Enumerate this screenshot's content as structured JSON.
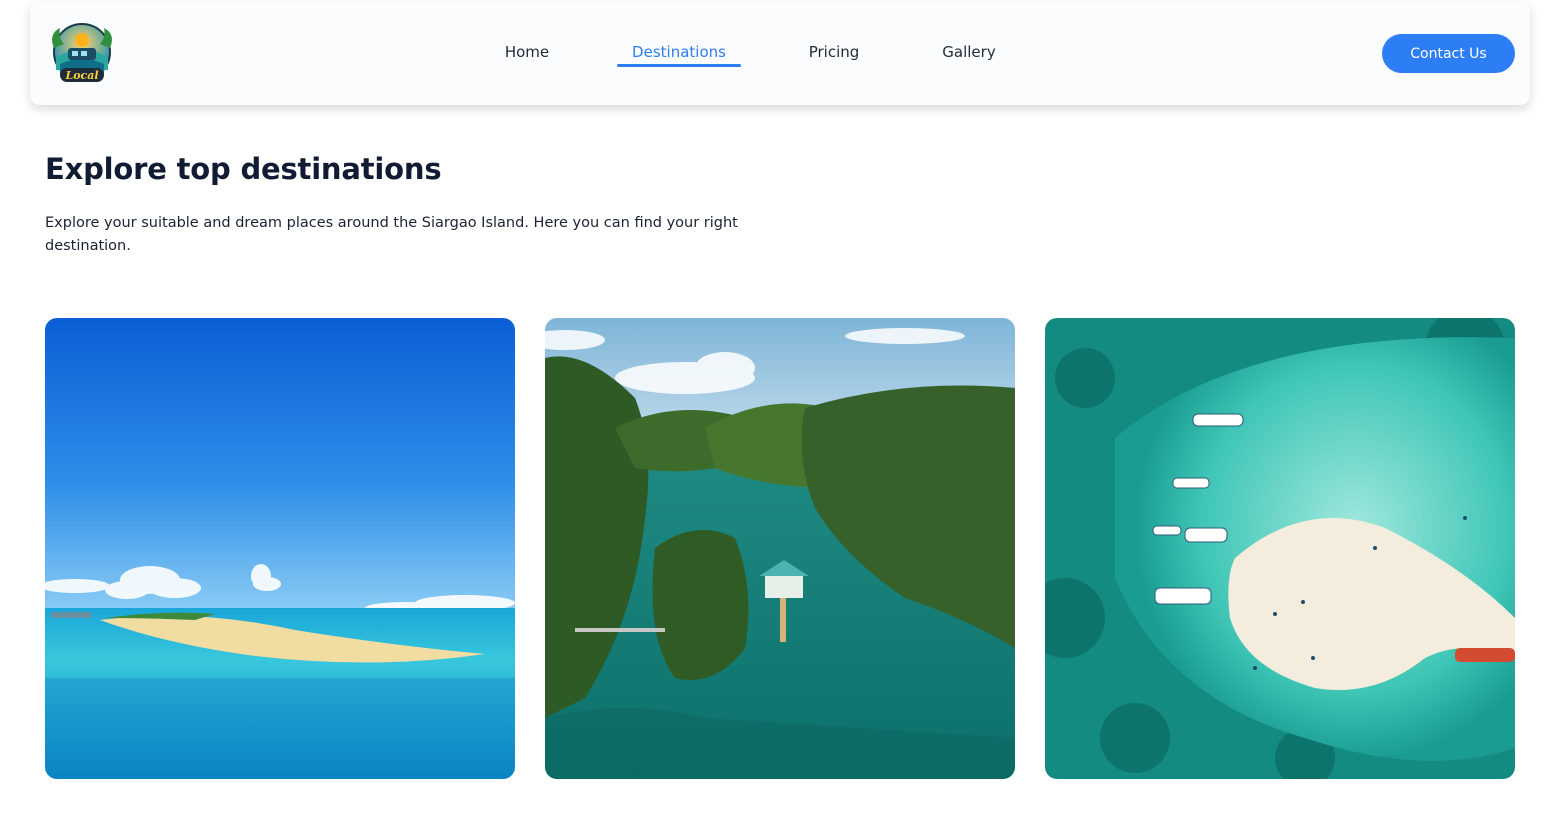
{
  "nav": {
    "links": [
      {
        "label": "Home",
        "active": false
      },
      {
        "label": "Destinations",
        "active": true
      },
      {
        "label": "Pricing",
        "active": false
      },
      {
        "label": "Gallery",
        "active": false
      }
    ],
    "contact_label": "Contact Us",
    "logo_text": "Local",
    "accent_color": "#2d7ef4"
  },
  "main": {
    "title": "Explore top destinations",
    "description": "Explore your suitable and dream places around the Siargao Island. Here you can find your right destination."
  },
  "cards": [
    {
      "icon": "sandbar-island-photo"
    },
    {
      "icon": "lagoon-islands-photo"
    },
    {
      "icon": "aerial-sandbar-photo"
    }
  ]
}
